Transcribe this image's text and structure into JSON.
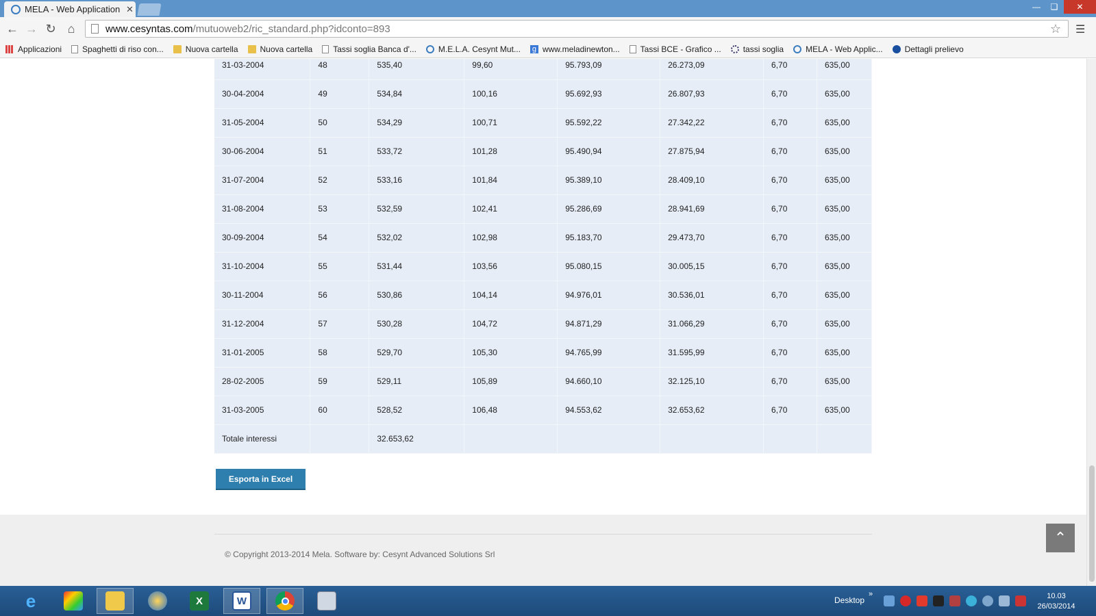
{
  "browser": {
    "tab_title": "MELA - Web Application p",
    "tab_close": "✕",
    "url_host": "www.cesyntas.com",
    "url_path": "/mutuoweb2/ric_standard.php?idconto=893",
    "bookmarks": [
      {
        "label": "Applicazioni",
        "icon": "apps-icon"
      },
      {
        "label": "Spaghetti di riso con...",
        "icon": "page-icon"
      },
      {
        "label": "Nuova cartella",
        "icon": "folder-icon"
      },
      {
        "label": "Nuova cartella",
        "icon": "folder-icon"
      },
      {
        "label": "Tassi soglia Banca d'...",
        "icon": "page-icon"
      },
      {
        "label": "M.E.L.A. Cesynt Mut...",
        "icon": "mela-icon"
      },
      {
        "label": "www.meladinewton...",
        "icon": "google-icon"
      },
      {
        "label": "Tassi BCE - Grafico ...",
        "icon": "page-icon"
      },
      {
        "label": "tassi soglia",
        "icon": "gear-icon"
      },
      {
        "label": "MELA - Web Applic...",
        "icon": "mela-icon"
      },
      {
        "label": "Dettagli prelievo",
        "icon": "circle-icon"
      }
    ]
  },
  "table": {
    "rows": [
      [
        "31-03-2004",
        "48",
        "535,40",
        "99,60",
        "95.793,09",
        "26.273,09",
        "6,70",
        "635,00"
      ],
      [
        "30-04-2004",
        "49",
        "534,84",
        "100,16",
        "95.692,93",
        "26.807,93",
        "6,70",
        "635,00"
      ],
      [
        "31-05-2004",
        "50",
        "534,29",
        "100,71",
        "95.592,22",
        "27.342,22",
        "6,70",
        "635,00"
      ],
      [
        "30-06-2004",
        "51",
        "533,72",
        "101,28",
        "95.490,94",
        "27.875,94",
        "6,70",
        "635,00"
      ],
      [
        "31-07-2004",
        "52",
        "533,16",
        "101,84",
        "95.389,10",
        "28.409,10",
        "6,70",
        "635,00"
      ],
      [
        "31-08-2004",
        "53",
        "532,59",
        "102,41",
        "95.286,69",
        "28.941,69",
        "6,70",
        "635,00"
      ],
      [
        "30-09-2004",
        "54",
        "532,02",
        "102,98",
        "95.183,70",
        "29.473,70",
        "6,70",
        "635,00"
      ],
      [
        "31-10-2004",
        "55",
        "531,44",
        "103,56",
        "95.080,15",
        "30.005,15",
        "6,70",
        "635,00"
      ],
      [
        "30-11-2004",
        "56",
        "530,86",
        "104,14",
        "94.976,01",
        "30.536,01",
        "6,70",
        "635,00"
      ],
      [
        "31-12-2004",
        "57",
        "530,28",
        "104,72",
        "94.871,29",
        "31.066,29",
        "6,70",
        "635,00"
      ],
      [
        "31-01-2005",
        "58",
        "529,70",
        "105,30",
        "94.765,99",
        "31.595,99",
        "6,70",
        "635,00"
      ],
      [
        "28-02-2005",
        "59",
        "529,11",
        "105,89",
        "94.660,10",
        "32.125,10",
        "6,70",
        "635,00"
      ],
      [
        "31-03-2005",
        "60",
        "528,52",
        "106,48",
        "94.553,62",
        "32.653,62",
        "6,70",
        "635,00"
      ]
    ],
    "total_label": "Totale interessi",
    "total_value": "32.653,62"
  },
  "export_label": "Esporta in Excel",
  "footer": {
    "copyright": "© Copyright 2013-2014 Mela. Software by: Cesynt Advanced Solutions Srl"
  },
  "taskbar": {
    "desktop_label": "Desktop",
    "time": "10.03",
    "date": "26/03/2014"
  },
  "colors": {
    "table_bg": "#e6edf7",
    "button_bg": "#2e7fae",
    "titlebar": "#5d94c9"
  }
}
